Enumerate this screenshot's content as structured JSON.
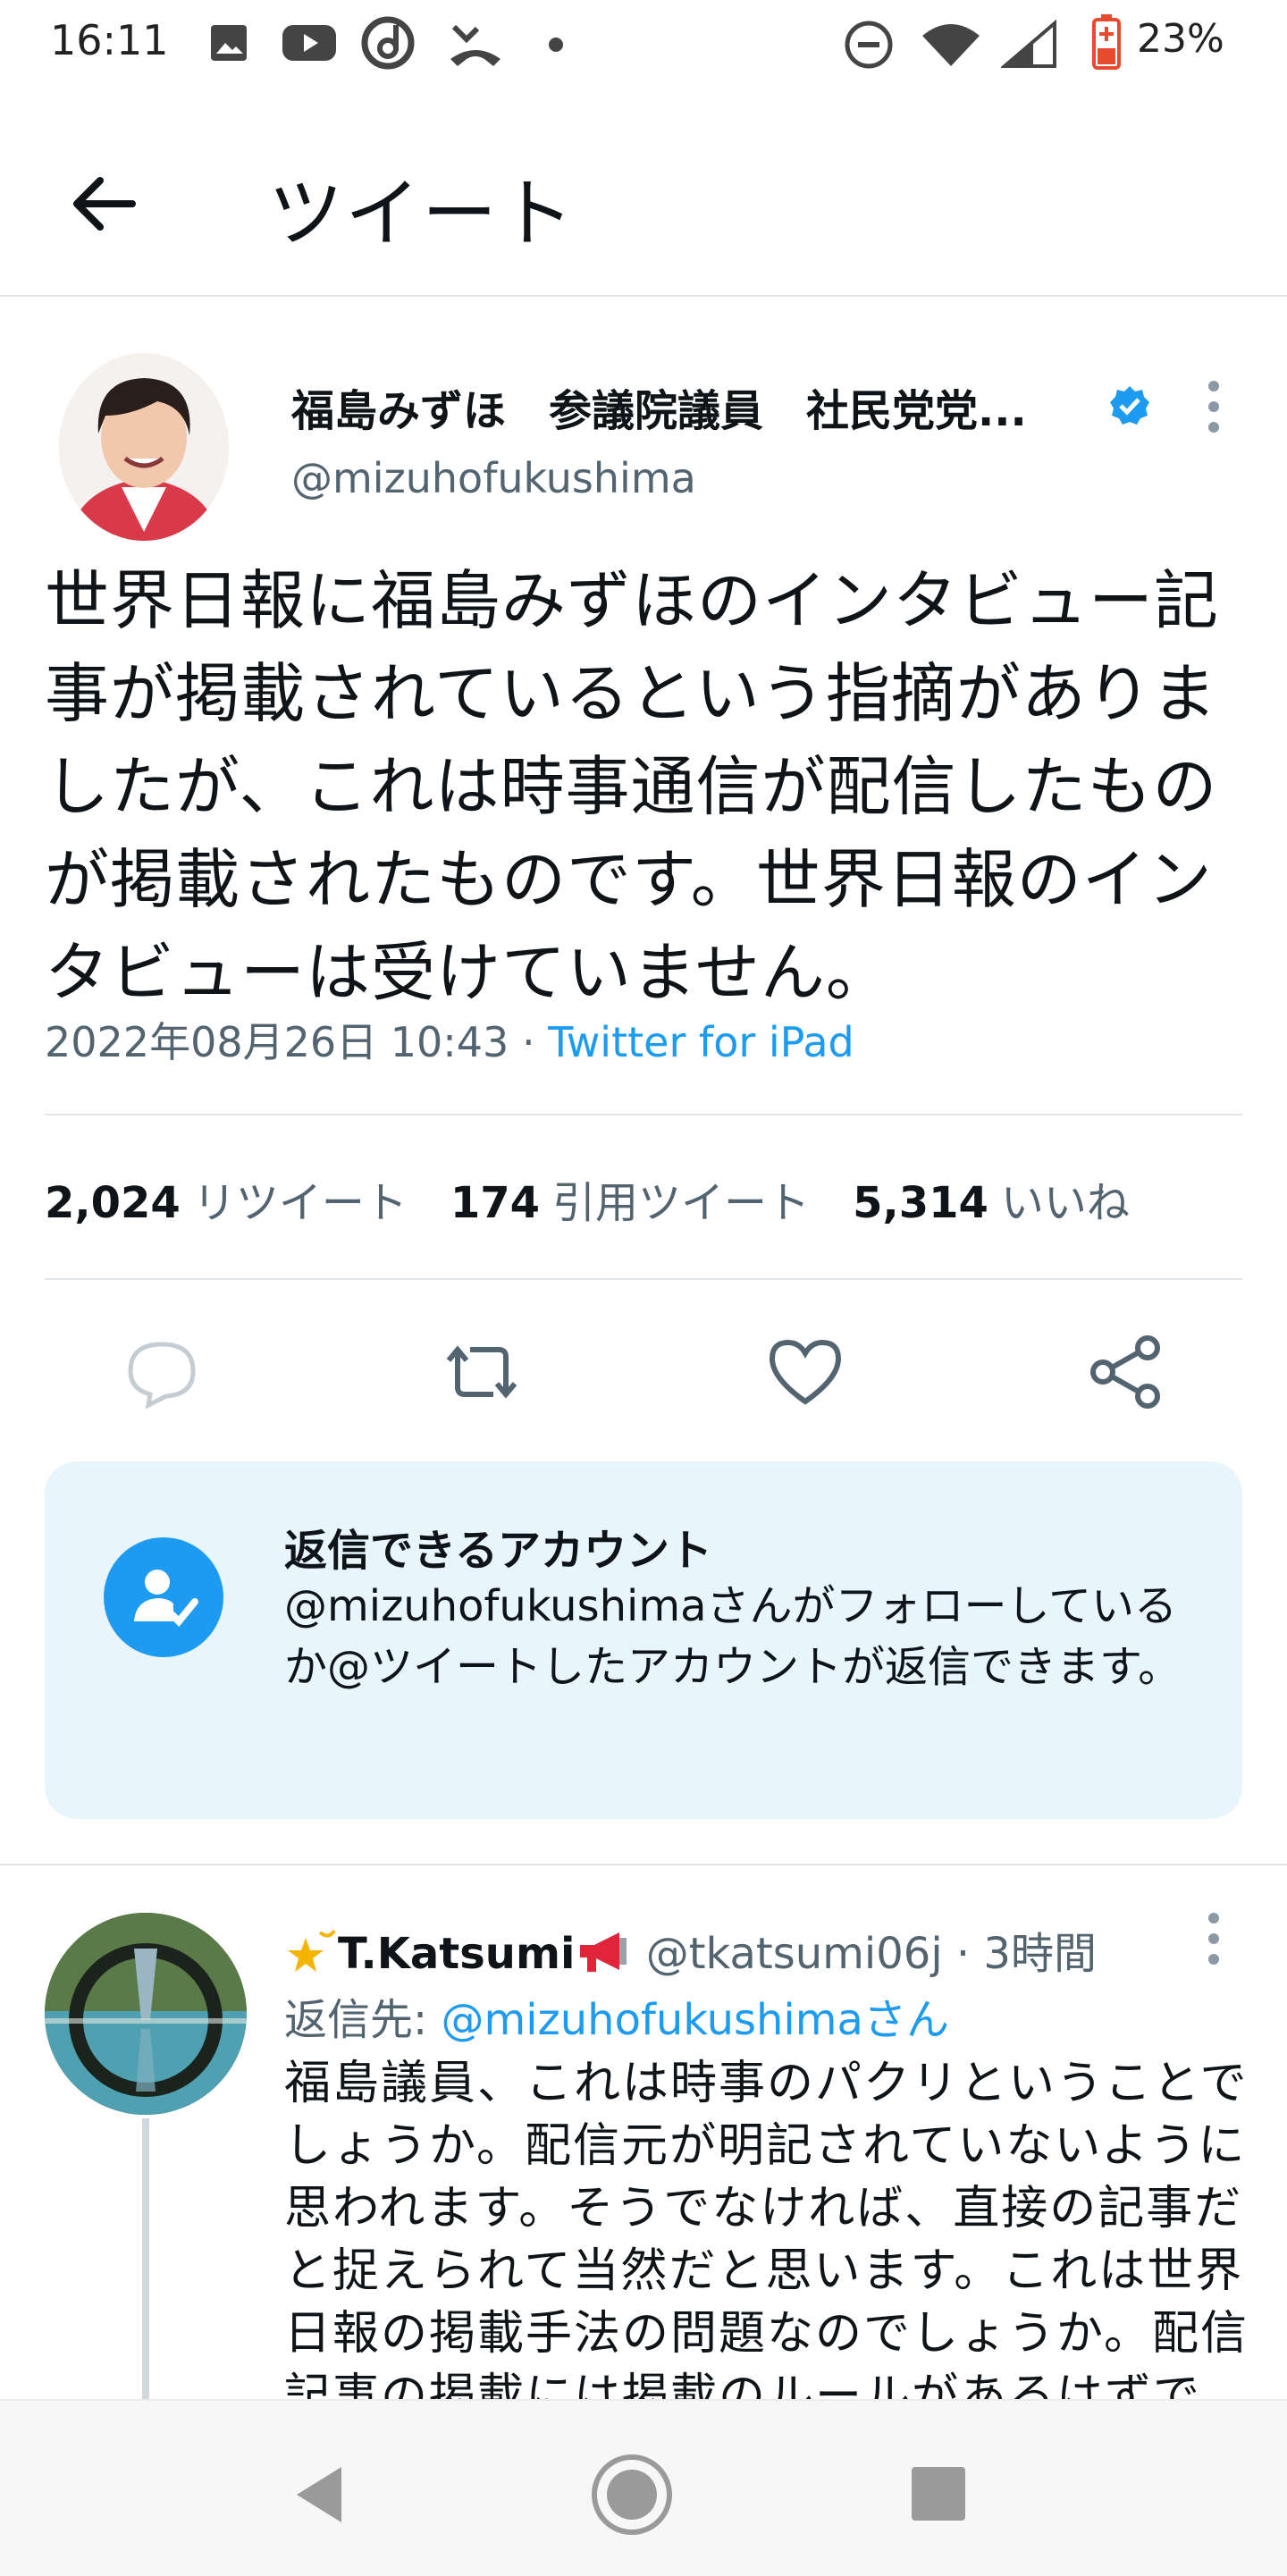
{
  "status_bar": {
    "time": "16:11",
    "battery_percent": "23%"
  },
  "header": {
    "title": "ツイート"
  },
  "tweet": {
    "display_name": "福島みずほ　参議院議員　社民党党...",
    "handle": "@mizuhofukushima",
    "text": "世界日報に福島みずほのインタビュー記事が掲載されているという指摘がありましたが、これは時事通信が配信したものが掲載されたものです。世界日報のインタビューは受けていません。",
    "timestamp": "2022年08月26日 10:43",
    "separator": " · ",
    "source": "Twitter for iPad",
    "stats": {
      "retweets_count": "2,024",
      "retweets_label": "リツイート",
      "quotes_count": "174",
      "quotes_label": "引用ツイート",
      "likes_count": "5,314",
      "likes_label": "いいね"
    }
  },
  "reply_restriction": {
    "heading": "返信できるアカウント",
    "body": "@mizuhofukushimaさんがフォローしているか@ツイートしたアカウントが返信できます。"
  },
  "reply": {
    "display_name": "T.Katsumi",
    "handle": "@tkatsumi06j",
    "time": " · 3時間",
    "replying_label": "返信先: ",
    "replying_to": "@mizuhofukushimaさん",
    "text": "福島議員、これは時事のパクリということでしょうか。配信元が明記されていないように思われます。そうでなければ、直接の記事だと捉えられて当然だと思います。これは世界日報の掲載手法の問題なのでしょうか。配信記事の掲載には掲載のルールがあるはずで"
  },
  "colors": {
    "accent": "#1d9bf0",
    "secondary_text": "#536471",
    "reply_box_bg": "#e8f5fd"
  }
}
